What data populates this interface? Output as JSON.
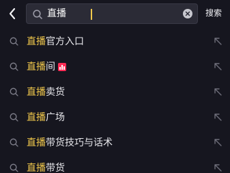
{
  "header": {
    "back_icon": "chevron-left-icon",
    "search": {
      "value": "直播",
      "clear_icon": "clear-circle-icon",
      "search_icon": "search-icon"
    },
    "search_button_label": "搜索"
  },
  "suggestions": [
    {
      "highlight": "直播",
      "rest": "官方入口",
      "badge": null
    },
    {
      "highlight": "直播",
      "rest": "间",
      "badge": "live-bars-icon"
    },
    {
      "highlight": "直播",
      "rest": "卖货",
      "badge": null
    },
    {
      "highlight": "直播",
      "rest": "广场",
      "badge": null
    },
    {
      "highlight": "直播",
      "rest": "带货技巧与话术",
      "badge": null
    },
    {
      "highlight": "直播",
      "rest": "带货",
      "badge": null
    }
  ],
  "colors": {
    "background": "#16161f",
    "highlight": "#f2c94c",
    "badge": "#fe2c55",
    "text": "#e8e8ec"
  }
}
